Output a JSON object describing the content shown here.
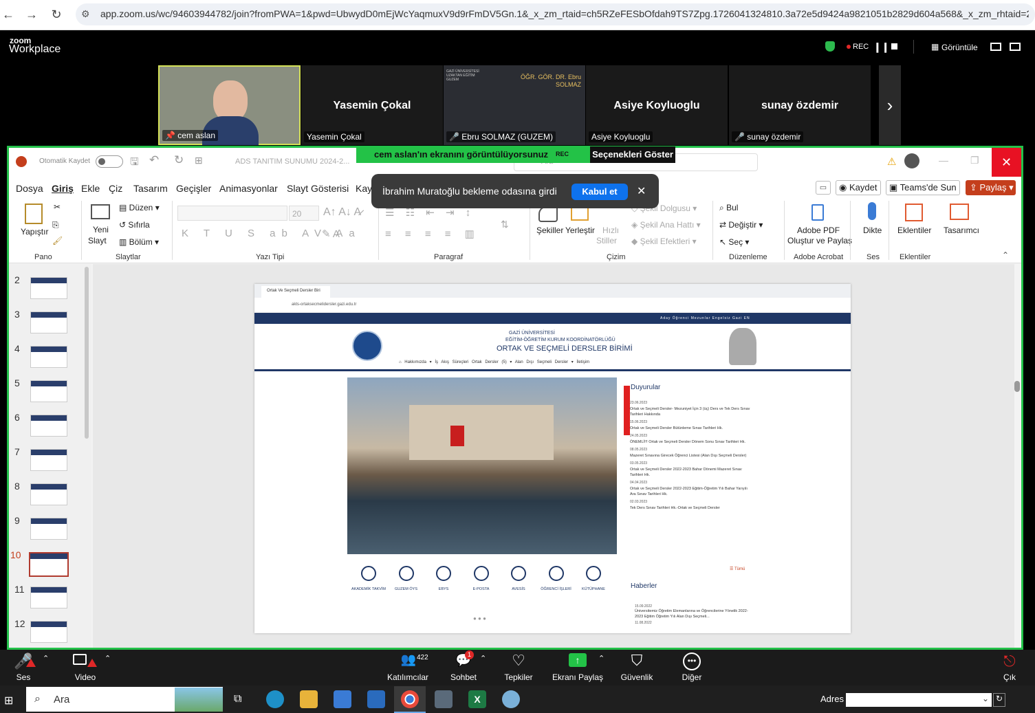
{
  "browser": {
    "url": "app.zoom.us/wc/94603944782/join?fromPWA=1&pwd=UbwydD0mEjWcYaqmuxV9d9rFmDV5Gn.1&_x_zm_rtaid=ch5RZeFESbOfdah9TS7Zpg.1726041324810.3a72e5d9424a9821051b2829d604a568&_x_zm_rhtaid=281"
  },
  "zoom": {
    "logo_small": "zoom",
    "logo": "Workplace",
    "rec": "REC",
    "view_label": "Görüntüle",
    "participants": [
      {
        "center": "",
        "label": "cem aslan"
      },
      {
        "center": "Yasemin Çokal",
        "label": "Yasemin Çokal"
      },
      {
        "center": "ÖĞR. GÖR. DR. Ebru SOLMAZ",
        "label": "Ebru SOLMAZ (GUZEM)"
      },
      {
        "center": "Asiye Koyluoglu",
        "label": "Asiye Koyluoglu"
      },
      {
        "center": "sunay özdemir",
        "label": "sunay özdemir"
      }
    ],
    "share_banner": "cem aslan'ın ekranını görüntülüyorsunuz",
    "share_rec": "REC",
    "options_button": "Seçenekleri Göster",
    "popup_text": "İbrahim Muratoğlu bekleme odasına girdi",
    "popup_accept": "Kabul et",
    "bottom": {
      "audio": "Ses",
      "video": "Video",
      "participants": "Katılımcılar",
      "participant_count": "422",
      "chat": "Sohbet",
      "chat_badge": "1",
      "reactions": "Tepkiler",
      "share": "Ekranı Paylaş",
      "security": "Güvenlik",
      "more": "Diğer",
      "leave": "Çık"
    }
  },
  "ppt": {
    "autosave": "Otomatik Kaydet",
    "doc_title": "ADS TANITIM SUNUMU 2024-2...",
    "search": "Ara",
    "menu": [
      "Dosya",
      "Giriş",
      "Ekle",
      "Çiz",
      "Tasarım",
      "Geçişler",
      "Animasyonlar",
      "Slayt Gösterisi",
      "Kay"
    ],
    "right_buttons": {
      "save": "Kaydet",
      "teams": "Teams'de Sun",
      "share": "Paylaş"
    },
    "ribbon": {
      "paste": "Yapıştır",
      "clipboard": "Pano",
      "new_slide_1": "Yeni",
      "new_slide_2": "Slayt",
      "layout": "Düzen",
      "reset": "Sıfırla",
      "section": "Bölüm",
      "slides": "Slaytlar",
      "font_size": "20",
      "font_group": "Yazı Tipi",
      "paragraph": "Paragraf",
      "shapes": "Şekiller",
      "arrange": "Yerleştir",
      "quick_styles_1": "Hızlı",
      "quick_styles_2": "Stiller",
      "shape_fill": "Şekil Dolgusu",
      "shape_outline": "Şekil Ana Hattı",
      "shape_effects": "Şekil Efektleri",
      "drawing": "Çizim",
      "find": "Bul",
      "replace": "Değiştir",
      "select": "Seç",
      "editing": "Düzenleme",
      "adobe_1": "Adobe PDF",
      "adobe_2": "Oluştur ve Paylaş",
      "adobe_group": "Adobe Acrobat",
      "dictate": "Dikte",
      "voice": "Ses",
      "addins": "Eklentiler",
      "addins_group": "Eklentiler",
      "designer": "Tasarımcı"
    },
    "slide_numbers": [
      "2",
      "3",
      "4",
      "5",
      "6",
      "7",
      "8",
      "9",
      "10",
      "11",
      "12"
    ]
  },
  "slide": {
    "tab_title": "Ortak Ve Seçmeli Dersler Biri",
    "url": "akts-ortaksecmelidersler.gazi.edu.tr",
    "topnav": [
      "Aday Öğrenci",
      "Mezunlar",
      "Engelsiz Gazi",
      "EN"
    ],
    "uni": "GAZİ ÜNİVERSİTESİ",
    "coord": "EĞİTİM-ÖĞRETİM KURUM KOORDİNATÖRLÜĞÜ",
    "unit": "ORTAK VE SEÇMELİ DERSLER BİRİMİ",
    "nav": [
      "Hakkımızda ▾",
      "İş Akış Süreçleri",
      "Ortak Dersler (5) ▾",
      "Alan Dışı Seçmeli Dersler ▾",
      "İletişim"
    ],
    "announcements_title": "Duyurular",
    "announcements": [
      {
        "date": "23.06.2023",
        "text": "Ortak ve Seçmeli Dersler- Mezuniyet İçin 3 (üç) Ders ve Tek Ders Sınav Tarihleri Hakkında"
      },
      {
        "date": "15.06.2023",
        "text": "Ortak ve Seçmeli Dersler Bütünleme Sınav Tarihleri Hk."
      },
      {
        "date": "24.05.2023",
        "text": "ÖNEMLİ!!! Ortak ve Seçmeli Dersler Dönem Sonu Sınav Tarihleri Hk."
      },
      {
        "date": "08.05.2023",
        "text": "Mazeret Sınavına Girecek Öğrenci Listesi (Alan Dışı Seçmeli Dersler)"
      },
      {
        "date": "03.05.2023",
        "text": "Ortak ve Seçmeli Dersler 2022-2023 Bahar Dönemi Mazeret Sınav Tarihleri Hk."
      },
      {
        "date": "04.04.2023",
        "text": "Ortak ve Seçmeli Dersler 2022-2023 Eğitim-Öğretim Yılı Bahar Yarıyılı Ara Sınav Tarihleri Hk."
      },
      {
        "date": "02.03.2023",
        "text": "Tek Ders Sınav Tarihleri Hk.-Ortak ve Seçmeli Dersler"
      }
    ],
    "all_link": "Tümü",
    "news_title": "Haberler",
    "news": [
      {
        "date": "15.09.2022",
        "text": "Üniversitemiz Öğretim Elemanlarına ve Öğrencilerine Yönelik 2022-2023 Eğitim Öğretim Yılı Alan Dışı Seçmeli..."
      },
      {
        "date": "11.08.2022",
        "text": ""
      }
    ],
    "quick_links": [
      "AKADEMİK TAKVİM",
      "GUZEM ÖYS",
      "EBYS",
      "E-POSTA",
      "AVESİS",
      "ÖĞRENCİ İŞLERİ",
      "KÜTÜPHANE"
    ]
  },
  "taskbar": {
    "search": "Ara",
    "address_label": "Adres"
  },
  "colors": {
    "zoom_green": "#23c247",
    "ppt_red": "#c43e1c",
    "accept_blue": "#0e72ed",
    "rec_red": "#e02828"
  }
}
